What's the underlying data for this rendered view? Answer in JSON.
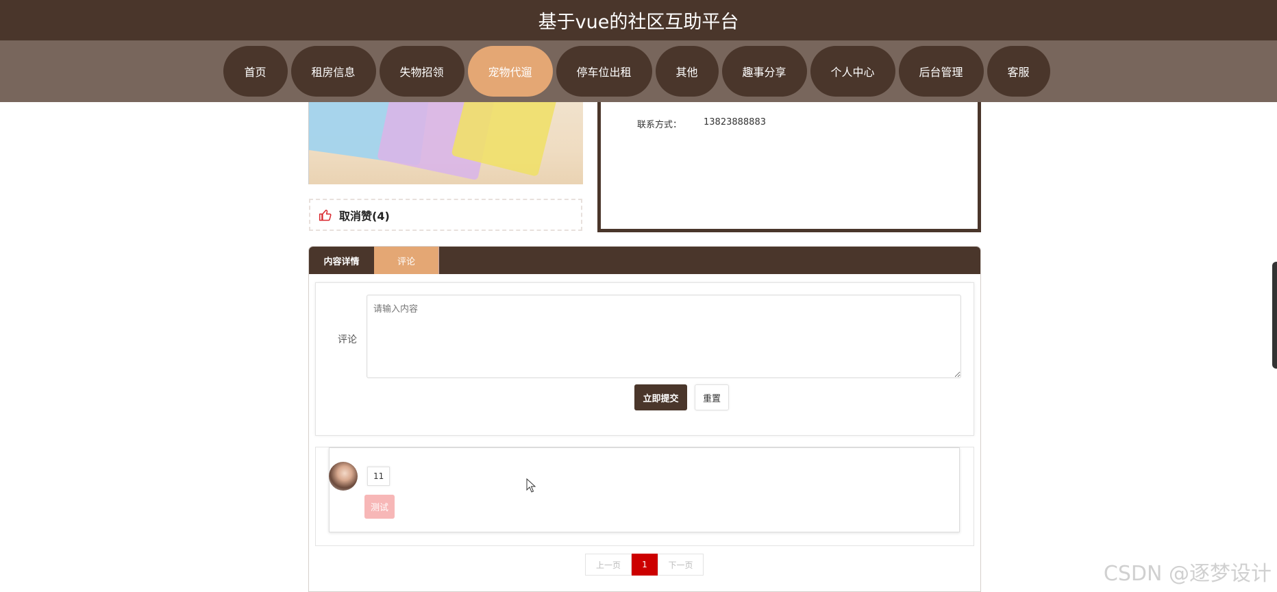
{
  "header": {
    "title": "基于vue的社区互助平台"
  },
  "nav": {
    "items": [
      {
        "label": "首页"
      },
      {
        "label": "租房信息"
      },
      {
        "label": "失物招领"
      },
      {
        "label": "宠物代遛",
        "active": true
      },
      {
        "label": "停车位出租"
      },
      {
        "label": "其他"
      },
      {
        "label": "趣事分享"
      },
      {
        "label": "个人中心"
      },
      {
        "label": "后台管理"
      },
      {
        "label": "客服"
      }
    ]
  },
  "detail": {
    "contact_label": "联系方式：",
    "contact_value": "13823888883",
    "like_label": "取消赞(4)"
  },
  "tabs": [
    {
      "label": "内容详情",
      "active": false
    },
    {
      "label": "评论",
      "active": true
    }
  ],
  "comment_form": {
    "label": "评论",
    "placeholder": "请输入内容",
    "submit_label": "立即提交",
    "reset_label": "重置"
  },
  "comments": [
    {
      "username": "11",
      "content": "测试"
    }
  ],
  "pagination": {
    "prev": "上一页",
    "current": "1",
    "next": "下一页"
  },
  "watermark": "CSDN @逐梦设计",
  "colors": {
    "brand_dark": "#4a362b",
    "nav_bg": "#78665c",
    "accent": "#e4a774",
    "page_active": "#cc0000"
  }
}
